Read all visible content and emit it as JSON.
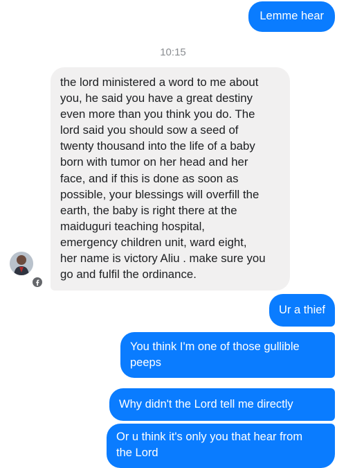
{
  "thread": {
    "messages": [
      {
        "direction": "outgoing",
        "text": "Lemme hear"
      },
      {
        "direction": "incoming",
        "text": "the lord ministered a word to me about\nyou, he said you have a great destiny\neven more than you think you do. The\nlord said you should sow a seed of\ntwenty thousand into the life of a baby\nborn with tumor on her head and her\nface, and if this is done as soon as\npossible, your blessings will overfill the\nearth, the baby is right there at the\nmaiduguri teaching hospital,\nemergency children unit, ward eight,\nher name is victory Aliu . make sure you\ngo and fulfil the ordinance."
      },
      {
        "direction": "outgoing",
        "text": "Ur a thief"
      },
      {
        "direction": "outgoing",
        "text": "You think I'm one of those gullible\npeeps"
      },
      {
        "direction": "outgoing",
        "text": "Why didn't the Lord tell me directly"
      },
      {
        "direction": "outgoing",
        "text": "Or u think it's only you that hear from\nthe Lord"
      }
    ],
    "timestamp": "10:15",
    "avatar_icon": "contact-avatar",
    "badge_icon": "facebook-badge-icon",
    "colors": {
      "outgoing_bubble": "#0a7cff",
      "incoming_bubble": "#f1f0f0",
      "timestamp_text": "#8a8d91"
    }
  }
}
